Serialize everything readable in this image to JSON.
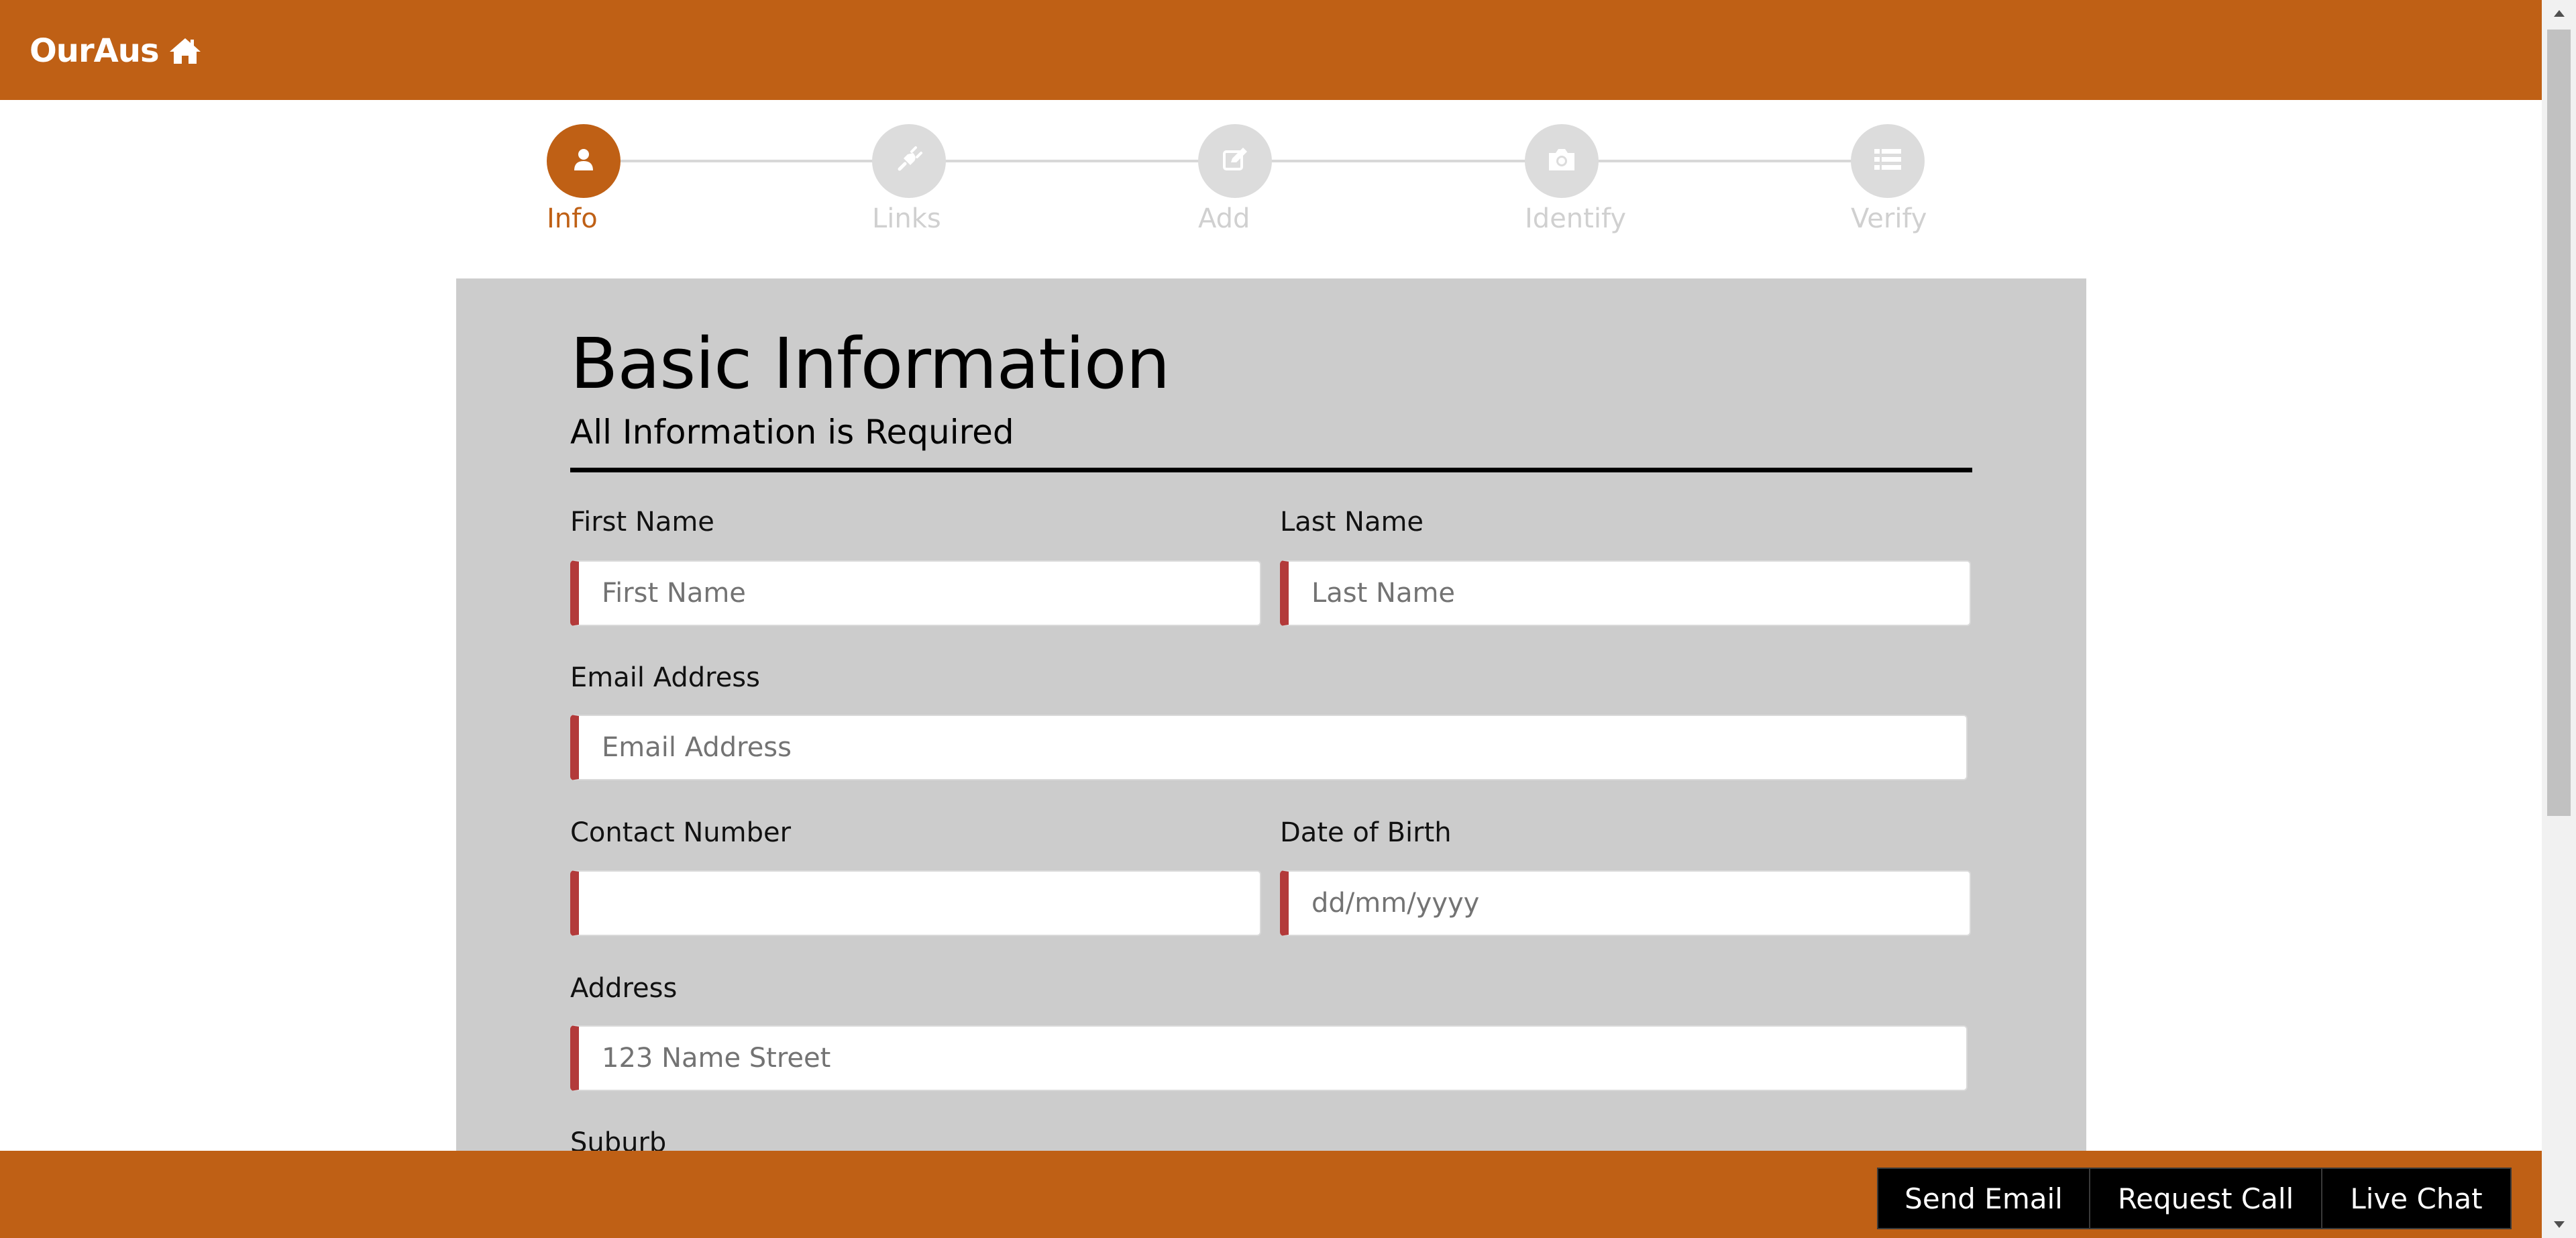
{
  "header": {
    "brand": "OurAus",
    "brand_icon": "home-icon",
    "background": "#bf6015"
  },
  "stepper": {
    "steps": [
      {
        "label": "Info",
        "icon": "user-icon",
        "active": true
      },
      {
        "label": "Links",
        "icon": "plug-icon",
        "active": false
      },
      {
        "label": "Add",
        "icon": "edit-icon",
        "active": false
      },
      {
        "label": "Identify",
        "icon": "camera-icon",
        "active": false
      },
      {
        "label": "Verify",
        "icon": "list-icon",
        "active": false
      }
    ],
    "active_color": "#bf6015",
    "inactive_color": "#dcdcdc"
  },
  "form": {
    "title": "Basic Information",
    "subtitle": "All Information is Required",
    "fields": {
      "first_name": {
        "label": "First Name",
        "placeholder": "First Name",
        "value": ""
      },
      "last_name": {
        "label": "Last Name",
        "placeholder": "Last Name",
        "value": ""
      },
      "email": {
        "label": "Email Address",
        "placeholder": "Email Address",
        "value": ""
      },
      "contact_number": {
        "label": "Contact Number",
        "placeholder": "",
        "value": ""
      },
      "dob": {
        "label": "Date of Birth",
        "placeholder": "dd/mm/yyyy",
        "value": ""
      },
      "address": {
        "label": "Address",
        "placeholder": "123 Name Street",
        "value": ""
      },
      "suburb": {
        "label": "Suburb"
      }
    },
    "required_marker_color": "#b33a3a"
  },
  "footer": {
    "buttons": {
      "send_email": "Send Email",
      "request_call": "Request Call",
      "live_chat": "Live Chat"
    }
  }
}
